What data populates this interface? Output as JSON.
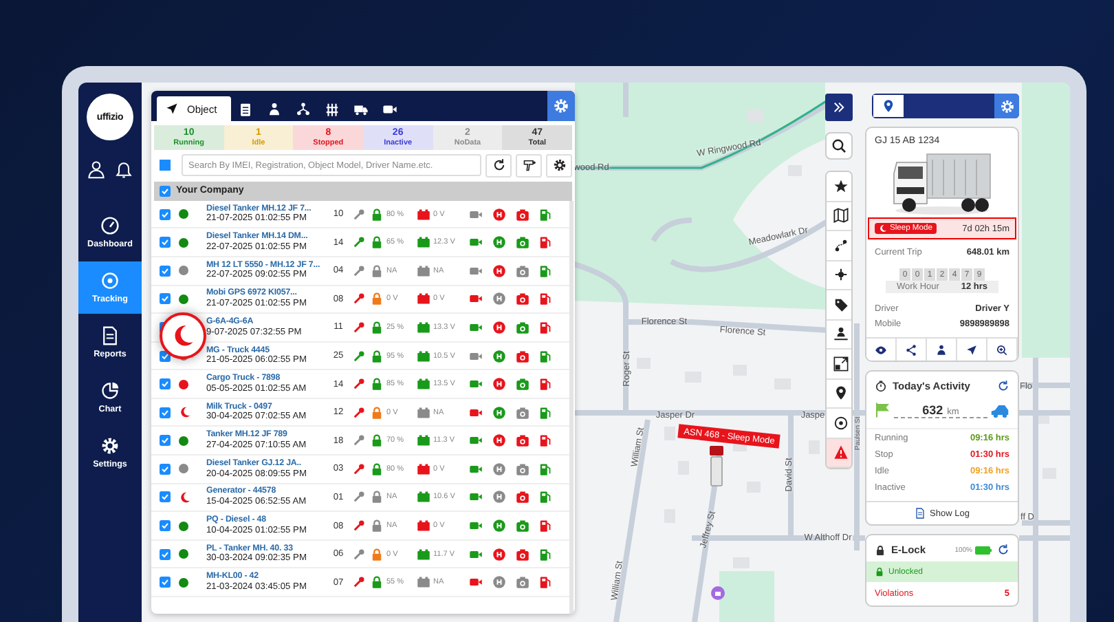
{
  "sidebar": {
    "logo": "uffizio",
    "items": [
      {
        "label": "Dashboard",
        "selected": false
      },
      {
        "label": "Tracking",
        "selected": true
      },
      {
        "label": "Reports",
        "selected": false
      },
      {
        "label": "Chart",
        "selected": false
      },
      {
        "label": "Settings",
        "selected": false
      }
    ]
  },
  "object_panel": {
    "tabs": [
      {
        "label": "Object",
        "selected": true
      },
      {
        "selected": false
      },
      {
        "selected": false
      },
      {
        "selected": false
      },
      {
        "selected": false
      },
      {
        "selected": false
      },
      {
        "selected": false
      }
    ],
    "status_counts": [
      {
        "count": "10",
        "label": "Running",
        "color": "#1f8f2a"
      },
      {
        "count": "1",
        "label": "Idle",
        "color": "#d39b00"
      },
      {
        "count": "8",
        "label": "Stopped",
        "color": "#e0141c"
      },
      {
        "count": "26",
        "label": "Inactive",
        "color": "#3a3ad6"
      },
      {
        "count": "2",
        "label": "NoData",
        "color": "#8a8a8a"
      },
      {
        "count": "47",
        "label": "Total",
        "color": "#333333"
      }
    ],
    "search": {
      "placeholder": "Search By IMEI, Registration, Object Model, Driver Name.etc."
    },
    "group": {
      "label": "Your Company",
      "checked": true
    },
    "rows": [
      {
        "checked": true,
        "status": {
          "kind": "dot",
          "color": "#138a13"
        },
        "name": "Diesel Tanker MH.12 JF 7...",
        "time": "21-07-2025 01:02:55 PM",
        "count": "10",
        "key": {
          "color": "#8a8a8a"
        },
        "lock": {
          "color": "#1a9a1a",
          "reading": "80 %"
        },
        "battery": {
          "color": "#e8141c",
          "reading": "0 V"
        },
        "video": {
          "color": "#8a8a8a"
        },
        "engine": {
          "color": "#e8141c"
        },
        "camera": {
          "color": "#e8141c"
        },
        "fuel": {
          "color": "#1a9a1a"
        }
      },
      {
        "checked": true,
        "status": {
          "kind": "dot",
          "color": "#138a13"
        },
        "name": "Diesel Tanker MH.14 DM...",
        "time": "22-07-2025 01:02:55 PM",
        "count": "14",
        "key": {
          "color": "#1a9a1a"
        },
        "lock": {
          "color": "#1a9a1a",
          "reading": "65 %"
        },
        "battery": {
          "color": "#1a9a1a",
          "reading": "12.3 V"
        },
        "video": {
          "color": "#1a9a1a"
        },
        "engine": {
          "color": "#1a9a1a"
        },
        "camera": {
          "color": "#1a9a1a"
        },
        "fuel": {
          "color": "#e8141c"
        }
      },
      {
        "checked": true,
        "status": {
          "kind": "dot",
          "color": "#8a8a8a"
        },
        "name": "MH 12 LT 5550 - MH.12 JF 7...",
        "time": "22-07-2025 09:02:55 PM",
        "count": "04",
        "key": {
          "color": "#8a8a8a"
        },
        "lock": {
          "color": "#8a8a8a",
          "reading": "NA"
        },
        "battery": {
          "color": "#8a8a8a",
          "reading": "NA"
        },
        "video": {
          "color": "#8a8a8a"
        },
        "engine": {
          "color": "#e8141c"
        },
        "camera": {
          "color": "#8a8a8a"
        },
        "fuel": {
          "color": "#1a9a1a"
        }
      },
      {
        "checked": true,
        "status": {
          "kind": "dot",
          "color": "#138a13"
        },
        "name": "Mobi GPS 6972 KI057...",
        "time": "21-07-2025 01:02:55 PM",
        "count": "08",
        "key": {
          "color": "#e8141c"
        },
        "lock": {
          "color": "#f07a1a",
          "reading": "0 V"
        },
        "battery": {
          "color": "#e8141c",
          "reading": "0 V"
        },
        "video": {
          "color": "#e8141c"
        },
        "engine": {
          "color": "#8a8a8a"
        },
        "camera": {
          "color": "#e8141c"
        },
        "fuel": {
          "color": "#e8141c"
        }
      },
      {
        "checked": true,
        "name": "G-6A-4G-6A",
        "time": "9-07-2025 07:32:55 PM",
        "count": "11",
        "key": {
          "color": "#e8141c"
        },
        "lock": {
          "color": "#1a9a1a",
          "reading": "25 %"
        },
        "battery": {
          "color": "#1a9a1a",
          "reading": "13.3 V"
        },
        "video": {
          "color": "#1a9a1a"
        },
        "engine": {
          "color": "#e8141c"
        },
        "camera": {
          "color": "#1a9a1a"
        },
        "fuel": {
          "color": "#e8141c"
        }
      },
      {
        "checked": true,
        "status": {
          "kind": "dot",
          "color": "#8a8a8a"
        },
        "name": "MG - Truck  4445",
        "time": "21-05-2025 06:02:55 PM",
        "count": "25",
        "key": {
          "color": "#1a9a1a"
        },
        "lock": {
          "color": "#1a9a1a",
          "reading": "95 %"
        },
        "battery": {
          "color": "#1a9a1a",
          "reading": "10.5 V"
        },
        "video": {
          "color": "#8a8a8a"
        },
        "engine": {
          "color": "#1a9a1a"
        },
        "camera": {
          "color": "#e8141c"
        },
        "fuel": {
          "color": "#1a9a1a"
        }
      },
      {
        "checked": true,
        "status": {
          "kind": "dot",
          "color": "#e8141c"
        },
        "name": "Cargo Truck - 7898",
        "time": "05-05-2025 01:02:55 AM",
        "count": "14",
        "key": {
          "color": "#e8141c"
        },
        "lock": {
          "color": "#1a9a1a",
          "reading": "85 %"
        },
        "battery": {
          "color": "#1a9a1a",
          "reading": "13.5 V"
        },
        "video": {
          "color": "#1a9a1a"
        },
        "engine": {
          "color": "#e8141c"
        },
        "camera": {
          "color": "#1a9a1a"
        },
        "fuel": {
          "color": "#e8141c"
        }
      },
      {
        "checked": true,
        "status": {
          "kind": "sleep",
          "color": "#e8141c"
        },
        "name": "Milk Truck - 0497",
        "time": "30-04-2025 07:02:55 AM",
        "count": "12",
        "key": {
          "color": "#e8141c"
        },
        "lock": {
          "color": "#f07a1a",
          "reading": "0 V"
        },
        "battery": {
          "color": "#8a8a8a",
          "reading": "NA"
        },
        "video": {
          "color": "#e8141c"
        },
        "engine": {
          "color": "#1a9a1a"
        },
        "camera": {
          "color": "#8a8a8a"
        },
        "fuel": {
          "color": "#1a9a1a"
        }
      },
      {
        "checked": true,
        "status": {
          "kind": "dot",
          "color": "#138a13"
        },
        "name": "Tanker MH.12 JF 789",
        "time": "27-04-2025 07:10:55 AM",
        "count": "18",
        "key": {
          "color": "#8a8a8a"
        },
        "lock": {
          "color": "#1a9a1a",
          "reading": "70 %"
        },
        "battery": {
          "color": "#1a9a1a",
          "reading": "11.3 V"
        },
        "video": {
          "color": "#1a9a1a"
        },
        "engine": {
          "color": "#e8141c"
        },
        "camera": {
          "color": "#e8141c"
        },
        "fuel": {
          "color": "#e8141c"
        }
      },
      {
        "checked": true,
        "status": {
          "kind": "dot",
          "color": "#8a8a8a"
        },
        "name": "Diesel Tanker GJ.12 JA..",
        "time": "20-04-2025 08:09:55 PM",
        "count": "03",
        "key": {
          "color": "#e8141c"
        },
        "lock": {
          "color": "#1a9a1a",
          "reading": "80 %"
        },
        "battery": {
          "color": "#e8141c",
          "reading": "0 V"
        },
        "video": {
          "color": "#1a9a1a"
        },
        "engine": {
          "color": "#8a8a8a"
        },
        "camera": {
          "color": "#8a8a8a"
        },
        "fuel": {
          "color": "#1a9a1a"
        }
      },
      {
        "checked": true,
        "status": {
          "kind": "sleep",
          "color": "#e8141c"
        },
        "name": "Generator - 44578",
        "time": "15-04-2025 06:52:55 AM",
        "count": "01",
        "key": {
          "color": "#8a8a8a"
        },
        "lock": {
          "color": "#8a8a8a",
          "reading": "NA"
        },
        "battery": {
          "color": "#1a9a1a",
          "reading": "10.6 V"
        },
        "video": {
          "color": "#1a9a1a"
        },
        "engine": {
          "color": "#8a8a8a"
        },
        "camera": {
          "color": "#e8141c"
        },
        "fuel": {
          "color": "#1a9a1a"
        }
      },
      {
        "checked": true,
        "status": {
          "kind": "dot",
          "color": "#138a13"
        },
        "name": "PQ - Diesel - 48",
        "time": "10-04-2025 01:02:55 PM",
        "count": "08",
        "key": {
          "color": "#e8141c"
        },
        "lock": {
          "color": "#8a8a8a",
          "reading": "NA"
        },
        "battery": {
          "color": "#e8141c",
          "reading": "0 V"
        },
        "video": {
          "color": "#1a9a1a"
        },
        "engine": {
          "color": "#1a9a1a"
        },
        "camera": {
          "color": "#1a9a1a"
        },
        "fuel": {
          "color": "#e8141c"
        }
      },
      {
        "checked": true,
        "status": {
          "kind": "dot",
          "color": "#138a13"
        },
        "name": "PL - Tanker MH. 40. 33",
        "time": "30-03-2024 09:02:35 PM",
        "count": "06",
        "key": {
          "color": "#8a8a8a"
        },
        "lock": {
          "color": "#f07a1a",
          "reading": "0 V"
        },
        "battery": {
          "color": "#1a9a1a",
          "reading": "11.7 V"
        },
        "video": {
          "color": "#1a9a1a"
        },
        "engine": {
          "color": "#e8141c"
        },
        "camera": {
          "color": "#e8141c"
        },
        "fuel": {
          "color": "#1a9a1a"
        }
      },
      {
        "checked": true,
        "status": {
          "kind": "dot",
          "color": "#138a13"
        },
        "name": "MH-KL00 - 42",
        "time": "21-03-2024 03:45:05 PM",
        "count": "07",
        "key": {
          "color": "#e8141c"
        },
        "lock": {
          "color": "#1a9a1a",
          "reading": "55 %"
        },
        "battery": {
          "color": "#8a8a8a",
          "reading": "NA"
        },
        "video": {
          "color": "#e8141c"
        },
        "engine": {
          "color": "#8a8a8a"
        },
        "camera": {
          "color": "#8a8a8a"
        },
        "fuel": {
          "color": "#e8141c"
        }
      }
    ]
  },
  "map": {
    "street_labels": [
      "W Ringwood Rd",
      "wood Rd",
      "Meadowlark Dr",
      "Florence St",
      "Florence St",
      "Roger St",
      "Jasper Dr",
      "Jaspe",
      "William St",
      "William St",
      "David St",
      "Jeffrey St",
      "W Althoff Dr",
      "Paulsen St",
      "Flo",
      "ff D"
    ],
    "marker_label": "ASN 468 - Sleep Mode"
  },
  "vehicle": {
    "plate": "GJ 15 AB 1234",
    "status": {
      "label": "Sleep Mode",
      "duration": "7d 02h 15m"
    },
    "trip": {
      "label": "Current Trip",
      "value": "648.01 km"
    },
    "odometer": [
      "0",
      "0",
      "1",
      "2",
      "4",
      "7",
      "9"
    ],
    "work_hour": {
      "label": "Work Hour",
      "value": "12 hrs"
    },
    "details": [
      {
        "label": "Driver",
        "value": "Driver Y"
      },
      {
        "label": "Mobile",
        "value": "9898989898"
      }
    ]
  },
  "activity": {
    "title": "Today's Activity",
    "distance": "632",
    "unit": "km",
    "items": [
      {
        "label": "Running",
        "value": "09:16 hrs",
        "color": "#5a9a1a"
      },
      {
        "label": "Stop",
        "value": "01:30 hrs",
        "color": "#e0141c"
      },
      {
        "label": "Idle",
        "value": "09:16 hrs",
        "color": "#f0a020"
      },
      {
        "label": "Inactive",
        "value": "01:30 hrs",
        "color": "#3a8ad6"
      }
    ],
    "show_log": "Show Log"
  },
  "elock": {
    "title": "E-Lock",
    "battery": "100%",
    "state": "Unlocked",
    "locked": false,
    "violations": {
      "label": "Violations",
      "value": "5"
    }
  }
}
